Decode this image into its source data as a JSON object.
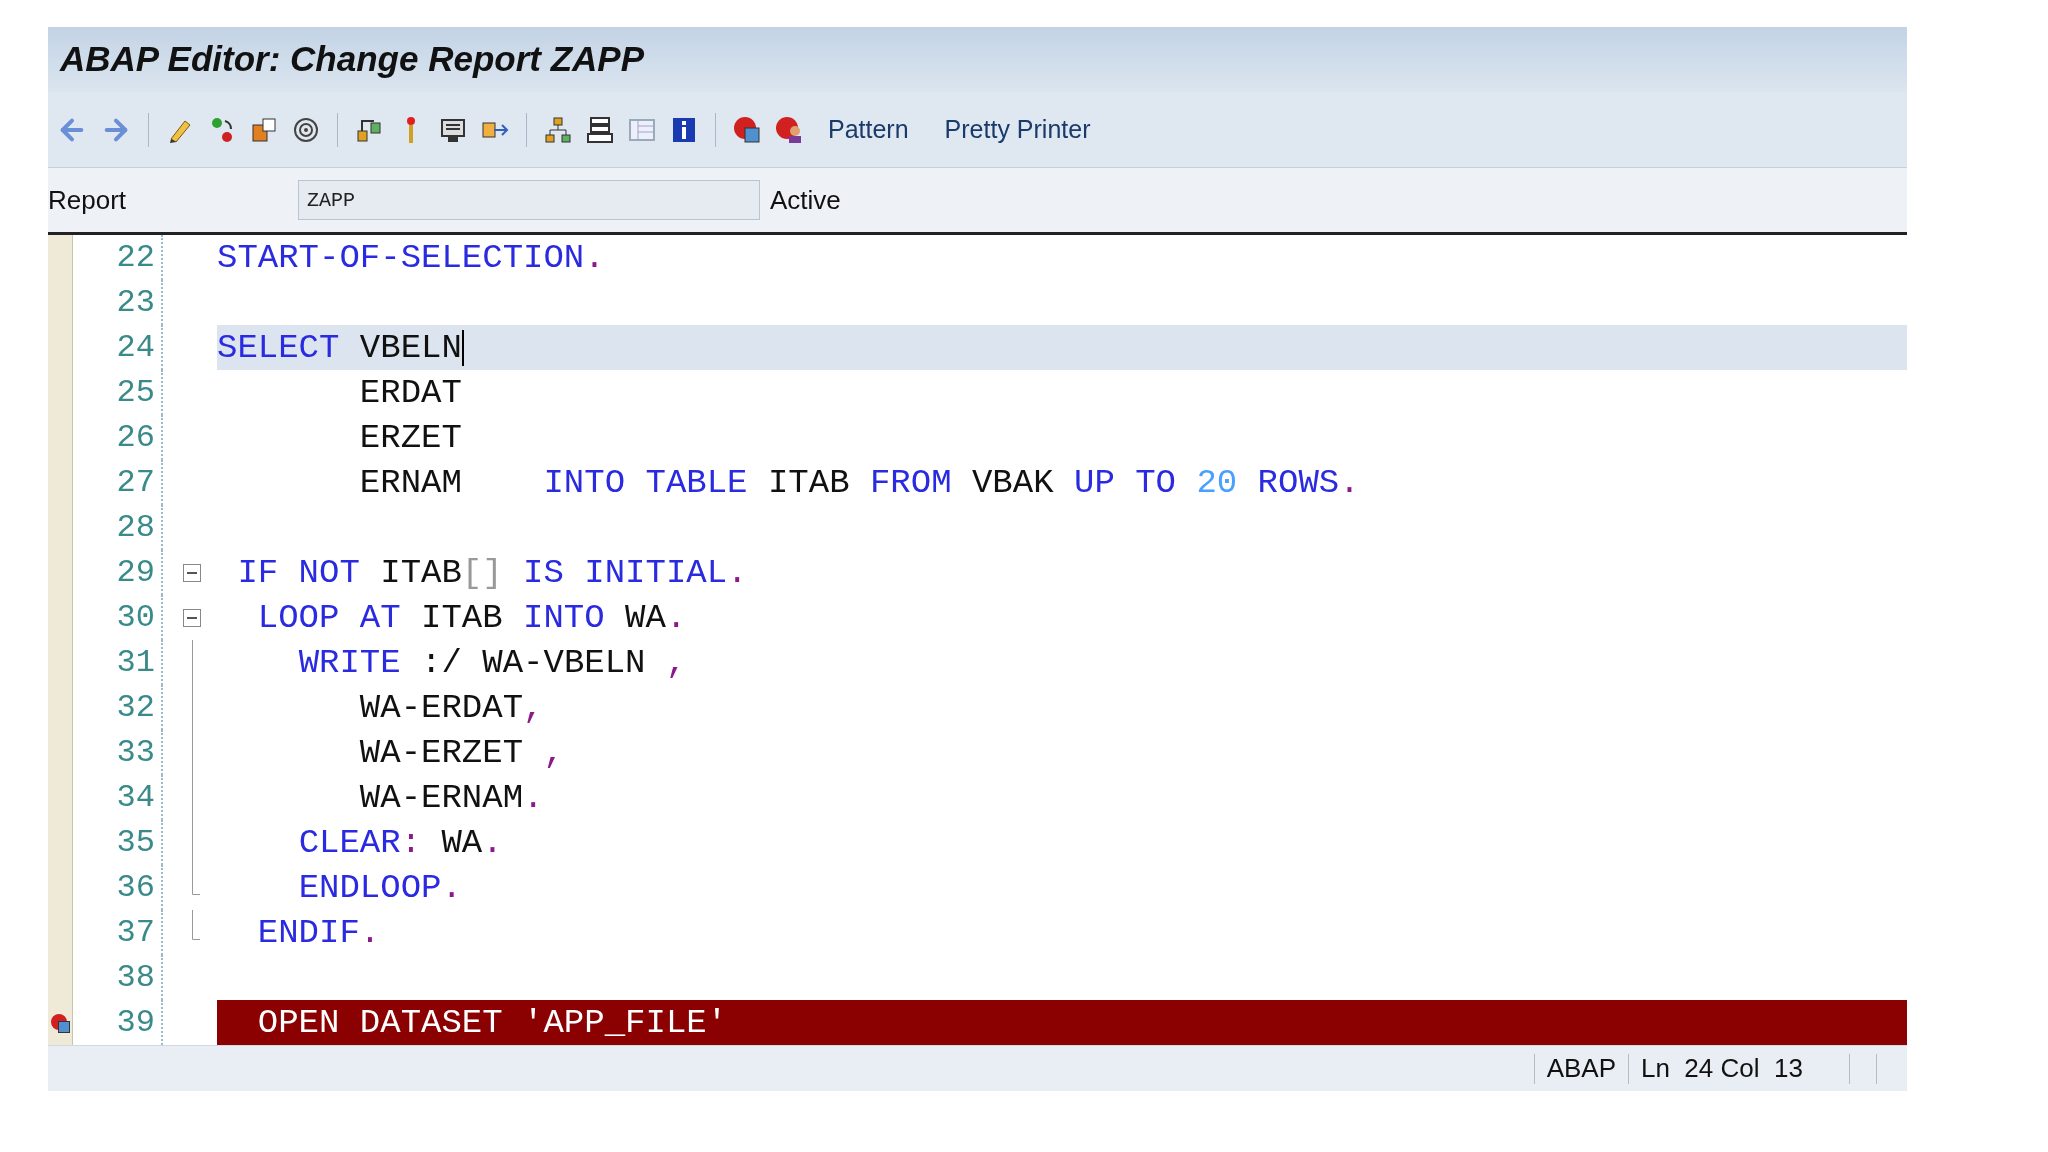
{
  "window": {
    "title": "ABAP Editor: Change Report ZAPP"
  },
  "toolbar": {
    "text_buttons": [
      "Pattern",
      "Pretty Printer"
    ]
  },
  "report": {
    "label": "Report",
    "value": "ZAPP",
    "status": "Active"
  },
  "editor": {
    "lines": [
      {
        "number": "22",
        "tokens": [
          {
            "text": "START-OF-SELECTION",
            "kind": "keyword"
          },
          {
            "text": ".",
            "kind": "punct"
          }
        ]
      },
      {
        "number": "23"
      },
      {
        "number": "24",
        "current": true,
        "tokens": [
          {
            "text": "SELECT",
            "kind": "keyword"
          },
          {
            "text": " VBELN",
            "kind": "ident"
          }
        ]
      },
      {
        "number": "25",
        "tokens": [
          {
            "text": "       ERDAT",
            "kind": "ident"
          }
        ]
      },
      {
        "number": "26",
        "tokens": [
          {
            "text": "       ERZET",
            "kind": "ident"
          }
        ]
      },
      {
        "number": "27",
        "tokens": [
          {
            "text": "       ERNAM    ",
            "kind": "ident"
          },
          {
            "text": "INTO TABLE",
            "kind": "keyword"
          },
          {
            "text": " ITAB ",
            "kind": "ident"
          },
          {
            "text": "FROM",
            "kind": "keyword"
          },
          {
            "text": " VBAK ",
            "kind": "ident"
          },
          {
            "text": "UP TO ",
            "kind": "keyword"
          },
          {
            "text": "20",
            "kind": "number"
          },
          {
            "text": " ROWS",
            "kind": "keyword"
          },
          {
            "text": ".",
            "kind": "punct"
          }
        ]
      },
      {
        "number": "28"
      },
      {
        "number": "29",
        "expanded": true,
        "tokens": [
          {
            "text": " IF NOT",
            "kind": "keyword"
          },
          {
            "text": " ITAB",
            "kind": "ident"
          },
          {
            "text": "[]",
            "kind": "bracket"
          },
          {
            "text": " IS INITIAL",
            "kind": "keyword"
          },
          {
            "text": ".",
            "kind": "punct"
          }
        ]
      },
      {
        "number": "30",
        "expanded": true,
        "tokens": [
          {
            "text": "  LOOP AT",
            "kind": "keyword"
          },
          {
            "text": " ITAB ",
            "kind": "ident"
          },
          {
            "text": "INTO",
            "kind": "keyword"
          },
          {
            "text": " WA",
            "kind": "ident"
          },
          {
            "text": ".",
            "kind": "punct"
          }
        ]
      },
      {
        "number": "31",
        "tokens": [
          {
            "text": "    WRITE",
            "kind": "keyword"
          },
          {
            "text": " :/ WA-VBELN ",
            "kind": "ident"
          },
          {
            "text": ",",
            "kind": "punct"
          }
        ]
      },
      {
        "number": "32",
        "tokens": [
          {
            "text": "       WA-ERDAT",
            "kind": "ident"
          },
          {
            "text": ",",
            "kind": "punct"
          }
        ]
      },
      {
        "number": "33",
        "tokens": [
          {
            "text": "       WA-ERZET ",
            "kind": "ident"
          },
          {
            "text": ",",
            "kind": "punct"
          }
        ]
      },
      {
        "number": "34",
        "tokens": [
          {
            "text": "       WA-ERNAM",
            "kind": "ident"
          },
          {
            "text": ".",
            "kind": "punct"
          }
        ]
      },
      {
        "number": "35",
        "tokens": [
          {
            "text": "    CLEAR",
            "kind": "keyword"
          },
          {
            "text": ":",
            "kind": "punct"
          },
          {
            "text": " WA",
            "kind": "ident"
          },
          {
            "text": ".",
            "kind": "punct"
          }
        ]
      },
      {
        "number": "36",
        "block_end": true,
        "tokens": [
          {
            "text": "    ENDLOOP",
            "kind": "keyword"
          },
          {
            "text": ".",
            "kind": "punct"
          }
        ]
      },
      {
        "number": "37",
        "block_end": true,
        "tokens": [
          {
            "text": "  ENDIF",
            "kind": "keyword"
          },
          {
            "text": ".",
            "kind": "punct"
          }
        ]
      },
      {
        "number": "38"
      },
      {
        "number": "39",
        "error": true,
        "tokens": [
          {
            "text": "  OPEN DATASET 'APP_FILE'",
            "kind": "ident"
          }
        ]
      }
    ]
  },
  "status_bar": {
    "language": "ABAP",
    "position": "Ln  24 Col  13"
  }
}
